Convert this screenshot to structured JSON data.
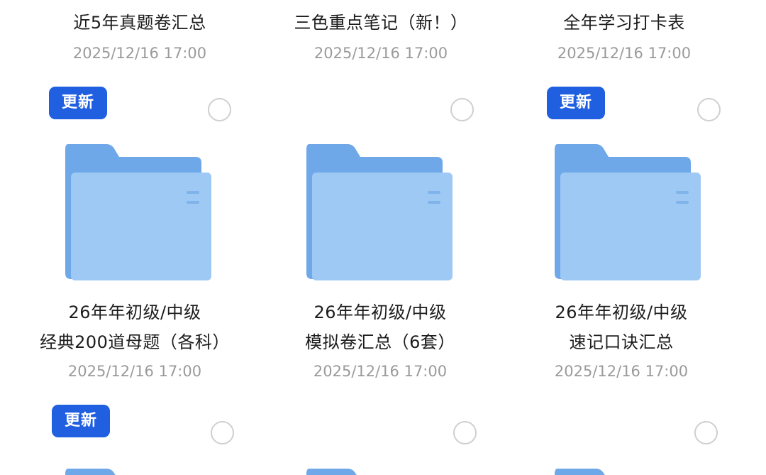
{
  "rows": [
    {
      "items": [
        {
          "title_lines": [
            "",
            "近5年真题卷汇总"
          ],
          "date": "2025/12/16  17:00"
        },
        {
          "title_lines": [
            "",
            "三色重点笔记（新！）"
          ],
          "date": "2025/12/16  17:00"
        },
        {
          "title_lines": [
            "",
            "全年学习打卡表"
          ],
          "date": "2025/12/16  17:00"
        }
      ]
    },
    {
      "items": [
        {
          "badge": "更新",
          "icon": "folder-icon",
          "title_lines": [
            "26年年初级/中级",
            "经典200道母题（各科）"
          ],
          "date": "2025/12/16  17:00"
        },
        {
          "badge": "",
          "icon": "folder-icon",
          "title_lines": [
            "26年年初级/中级",
            "模拟卷汇总（6套）"
          ],
          "date": "2025/12/16  17:00"
        },
        {
          "badge": "更新",
          "icon": "folder-icon",
          "title_lines": [
            "26年年初级/中级",
            "速记口诀汇总"
          ],
          "date": "2025/12/16  17:00"
        }
      ]
    },
    {
      "items": [
        {
          "badge": "更新",
          "icon": "folder-icon"
        },
        {
          "badge": "",
          "icon": "folder-icon"
        },
        {
          "badge": "",
          "icon": "folder-icon"
        }
      ]
    }
  ],
  "colors": {
    "badge_bg": "#1f5fe0",
    "folder_back": "#6fa8e8",
    "folder_front": "#9ec9f5",
    "date_text": "#9a9a9a"
  }
}
